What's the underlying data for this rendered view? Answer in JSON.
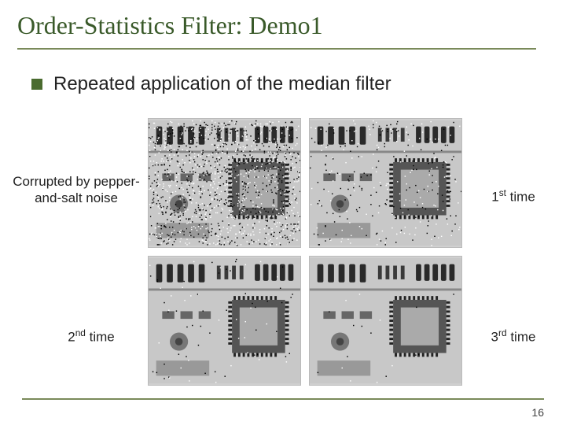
{
  "title": "Order-Statistics Filter: Demo1",
  "bullet": "Repeated application of the median filter",
  "labels": {
    "topLeft": "Corrupted by pepper-\nand-salt noise",
    "topRight_pre": "1",
    "topRight_sup": "st",
    "topRight_post": " time",
    "botLeft_pre": "2",
    "botLeft_sup": "nd",
    "botLeft_post": " time",
    "botRight_pre": "3",
    "botRight_sup": "rd",
    "botRight_post": " time"
  },
  "pageNumber": "16",
  "images": {
    "tl": {
      "noise": 0.35
    },
    "tr": {
      "noise": 0.08
    },
    "bl": {
      "noise": 0.02
    },
    "br": {
      "noise": 0.005
    }
  }
}
